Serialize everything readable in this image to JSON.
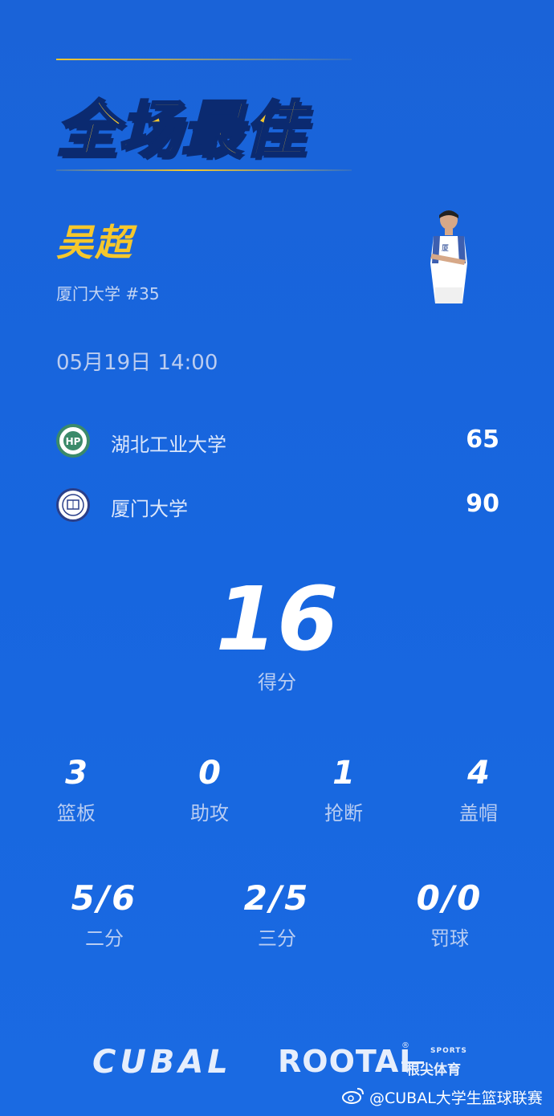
{
  "header": {
    "title": "全场最佳"
  },
  "player": {
    "name": "吴超",
    "school_number": "厦门大学 #35"
  },
  "match": {
    "datetime": "05月19日 14:00",
    "teams": [
      {
        "name": "湖北工业大学",
        "score": "65"
      },
      {
        "name": "厦门大学",
        "score": "90"
      }
    ]
  },
  "points": {
    "value": "16",
    "label": "得分"
  },
  "stats": [
    {
      "value": "3",
      "label": "篮板"
    },
    {
      "value": "0",
      "label": "助攻"
    },
    {
      "value": "1",
      "label": "抢断"
    },
    {
      "value": "4",
      "label": "盖帽"
    }
  ],
  "shooting": [
    {
      "value": "5/6",
      "label": "二分"
    },
    {
      "value": "2/5",
      "label": "三分"
    },
    {
      "value": "0/0",
      "label": "罚球"
    }
  ],
  "footer": {
    "cubal": "CUBAL",
    "rootai": "ROOTAI",
    "registered": "®",
    "sports": "SPORTS",
    "rootai_cn": "根尖体育",
    "weibo_handle": "@CUBAL大学生篮球联赛"
  },
  "colors": {
    "background": "#1766df",
    "title_gold": "#f5c72c",
    "outline": "#0b2a70"
  }
}
